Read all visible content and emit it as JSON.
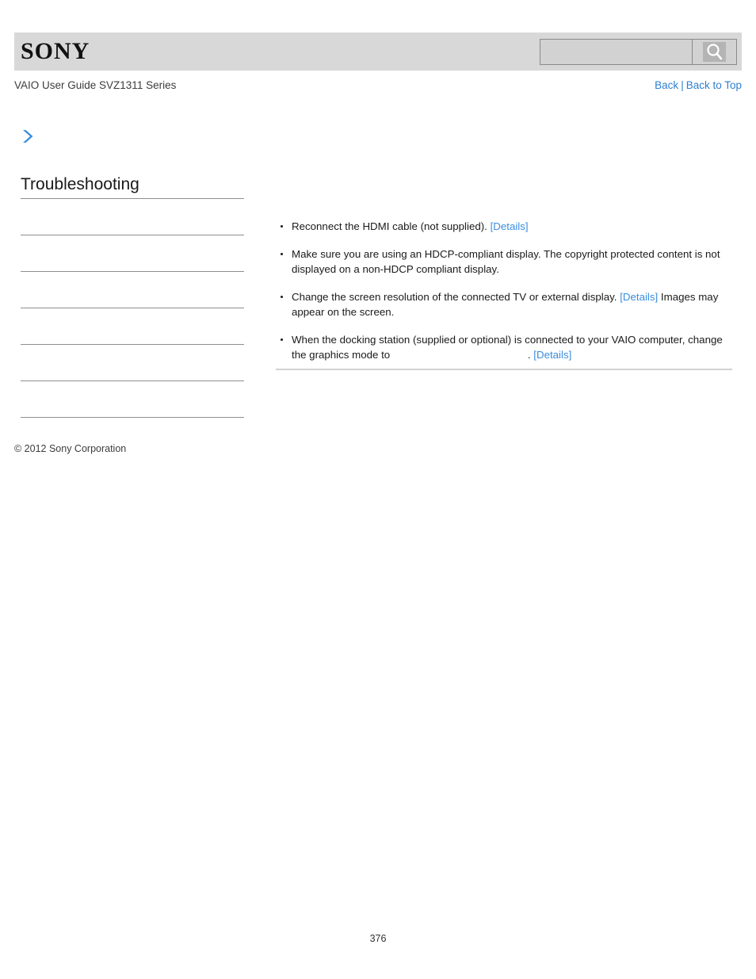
{
  "header": {
    "brand_logo_text": "SONY",
    "search": {
      "value": "",
      "placeholder": "",
      "button_icon": "search-icon"
    },
    "bar_color": "#d8d8d8"
  },
  "subheader": {
    "guide_title": "VAIO User Guide SVZ1311 Series",
    "links": {
      "back": "Back",
      "separator": "|",
      "back_to_top": "Back to Top"
    },
    "link_color": "#2f7fd0"
  },
  "sidebar": {
    "chevron_icon": "chevron-right-icon",
    "chevron_color": "#3a8ddd",
    "section_title": "Troubleshooting",
    "items": [
      {
        "label": ""
      },
      {
        "label": ""
      },
      {
        "label": ""
      },
      {
        "label": ""
      },
      {
        "label": ""
      },
      {
        "label": ""
      }
    ],
    "rule_color": "#8e8e8e"
  },
  "content": {
    "bullets": [
      {
        "id": "bullet-hdmi-reconnect",
        "segments": [
          {
            "type": "text",
            "value": "Reconnect the HDMI cable (not supplied). "
          },
          {
            "type": "link",
            "value": "[Details]"
          }
        ]
      },
      {
        "id": "bullet-hdcp-display",
        "segments": [
          {
            "type": "text",
            "value": "Make sure you are using an HDCP-compliant display. The copyright protected content is not displayed on a non-HDCP compliant display."
          }
        ]
      },
      {
        "id": "bullet-screen-resolution",
        "segments": [
          {
            "type": "text",
            "value": "Change the screen resolution of the connected TV or external display. "
          },
          {
            "type": "link",
            "value": "[Details]"
          },
          {
            "type": "text",
            "value": " Images may appear on the screen."
          }
        ]
      },
      {
        "id": "bullet-docking-station",
        "segments": [
          {
            "type": "text",
            "value": "When the docking station (supplied or optional) is connected to your VAIO computer, change the graphics mode to "
          },
          {
            "type": "blank",
            "value": ""
          },
          {
            "type": "text",
            "value": ". "
          },
          {
            "type": "link",
            "value": "[Details]"
          }
        ]
      }
    ],
    "rule_color": "#d2d2d2",
    "link_color": "#3a8ddd"
  },
  "footer": {
    "copyright": "© 2012 Sony Corporation",
    "page_number": "376"
  }
}
